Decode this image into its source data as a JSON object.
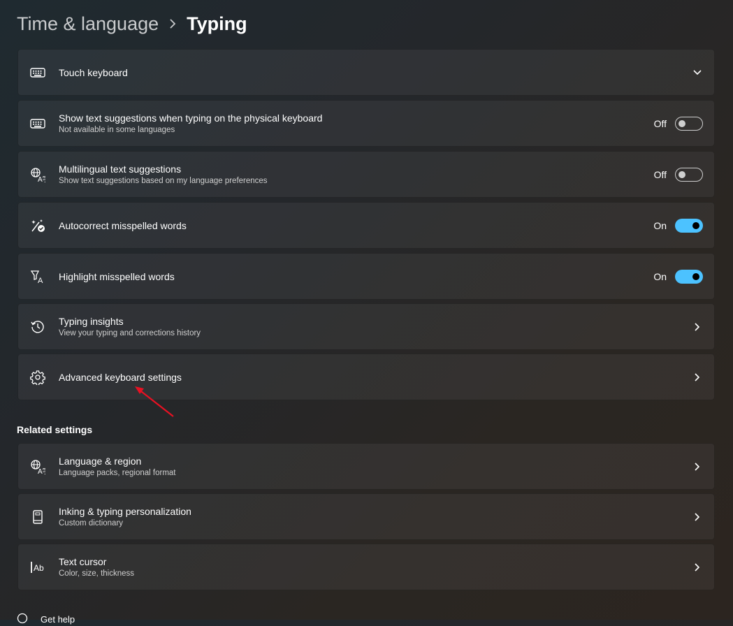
{
  "header": {
    "parent": "Time & language",
    "current": "Typing"
  },
  "typing_settings": [
    {
      "key": "touch",
      "icon": "keyboard-icon",
      "title": "Touch keyboard",
      "subtitle": "",
      "control": "expand"
    },
    {
      "key": "suggest",
      "icon": "keyboard-icon",
      "title": "Show text suggestions when typing on the physical keyboard",
      "subtitle": "Not available in some languages",
      "control": "toggle",
      "state": "Off"
    },
    {
      "key": "multi",
      "icon": "language-icon",
      "title": "Multilingual text suggestions",
      "subtitle": "Show text suggestions based on my language preferences",
      "control": "toggle",
      "state": "Off"
    },
    {
      "key": "autocorrect",
      "icon": "autocorrect-icon",
      "title": "Autocorrect misspelled words",
      "subtitle": "",
      "control": "toggle",
      "state": "On"
    },
    {
      "key": "highlight",
      "icon": "highlight-icon",
      "title": "Highlight misspelled words",
      "subtitle": "",
      "control": "toggle",
      "state": "On"
    },
    {
      "key": "insights",
      "icon": "history-icon",
      "title": "Typing insights",
      "subtitle": "View your typing and corrections history",
      "control": "link"
    },
    {
      "key": "advanced",
      "icon": "gear-icon",
      "title": "Advanced keyboard settings",
      "subtitle": "",
      "control": "link"
    }
  ],
  "related": {
    "heading": "Related settings",
    "items": [
      {
        "key": "language",
        "icon": "language-icon",
        "title": "Language & region",
        "subtitle": "Language packs, regional format"
      },
      {
        "key": "inking",
        "icon": "dictionary-icon",
        "title": "Inking & typing personalization",
        "subtitle": "Custom dictionary"
      },
      {
        "key": "cursor",
        "icon": "text-cursor-icon",
        "title": "Text cursor",
        "subtitle": "Color, size, thickness"
      }
    ]
  },
  "footer": {
    "get_help": "Get help"
  },
  "colors": {
    "accent": "#4cc2ff",
    "annotation_arrow": "#e81123"
  }
}
